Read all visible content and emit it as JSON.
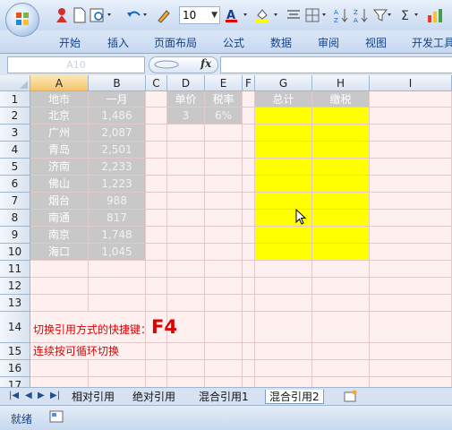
{
  "toolbar": {
    "font_size": "10"
  },
  "ribbon": {
    "tabs": [
      "开始",
      "插入",
      "页面布局",
      "公式",
      "数据",
      "审阅",
      "视图",
      "开发工具"
    ]
  },
  "formula_bar": {
    "name_box": "A10",
    "fx": "fx",
    "content": ""
  },
  "sheet": {
    "columns": [
      "A",
      "B",
      "C",
      "D",
      "E",
      "F",
      "G",
      "H",
      "I"
    ],
    "selected_column": "A",
    "rows": [
      "1",
      "2",
      "3",
      "4",
      "5",
      "6",
      "7",
      "8",
      "9",
      "10",
      "11",
      "12",
      "13",
      "14",
      "15",
      "16",
      "17"
    ],
    "headers": {
      "A1": "地市",
      "B1": "一月",
      "D1": "单价",
      "E1": "税率",
      "G1": "总计",
      "H1": "缴税"
    },
    "values": {
      "D2": "3",
      "E2": "6%"
    },
    "cities": [
      "北京",
      "广州",
      "青岛",
      "济南",
      "佛山",
      "烟台",
      "南通",
      "南京",
      "海口"
    ],
    "january": [
      "1,486",
      "2,087",
      "2,501",
      "2,233",
      "1,223",
      "988",
      "817",
      "1,748",
      "1,045"
    ],
    "tip_text": "切换引用方式的快捷键：",
    "tip_key": "F4",
    "tip_sub": "连续按可循环切换",
    "colors": {
      "highlight": "#ffff00",
      "header_fill": "#c8c8c8",
      "grid_fill": "#fff0f0",
      "tip_color": "#e00000"
    }
  },
  "sheet_tabs": {
    "tabs": [
      "相对引用",
      "绝对引用",
      "混合引用1",
      "混合引用2"
    ],
    "active": "混合引用2"
  },
  "status_bar": {
    "mode": "就绪"
  }
}
